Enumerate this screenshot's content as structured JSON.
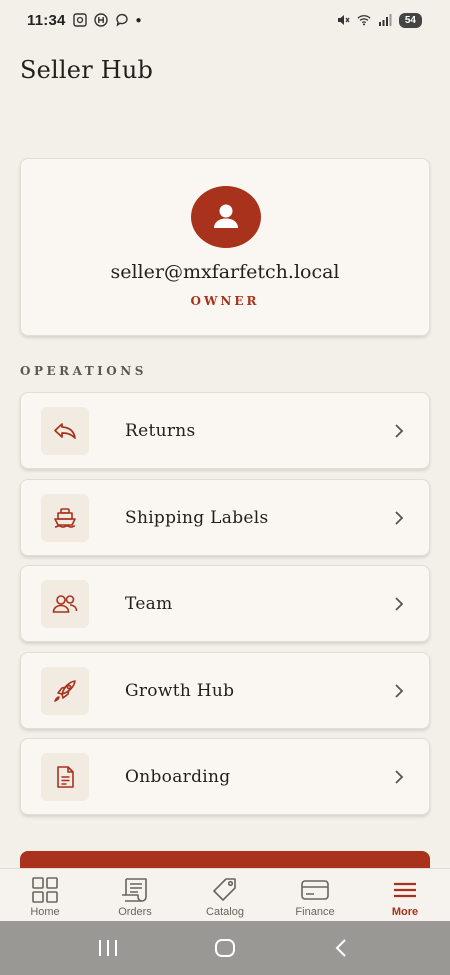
{
  "status_bar": {
    "time": "11:34",
    "battery": "54"
  },
  "page": {
    "title": "Seller Hub"
  },
  "profile": {
    "email": "seller@mxfarfetch.local",
    "role": "OWNER",
    "avatar_icon": "user-icon"
  },
  "operations": {
    "section_label": "OPERATIONS",
    "items": [
      {
        "label": "Returns",
        "icon": "return-arrow-icon"
      },
      {
        "label": "Shipping Labels",
        "icon": "ship-icon"
      },
      {
        "label": "Team",
        "icon": "team-icon"
      },
      {
        "label": "Growth Hub",
        "icon": "rocket-icon"
      },
      {
        "label": "Onboarding",
        "icon": "document-icon"
      }
    ]
  },
  "tab_bar": {
    "tabs": [
      {
        "label": "Home",
        "icon": "grid-icon"
      },
      {
        "label": "Orders",
        "icon": "receipt-icon"
      },
      {
        "label": "Catalog",
        "icon": "tag-icon"
      },
      {
        "label": "Finance",
        "icon": "card-icon"
      },
      {
        "label": "More",
        "icon": "menu-icon",
        "active": true
      }
    ]
  },
  "colors": {
    "accent": "#a8321c",
    "background": "#f3f0ea",
    "card": "#faf7f2"
  }
}
